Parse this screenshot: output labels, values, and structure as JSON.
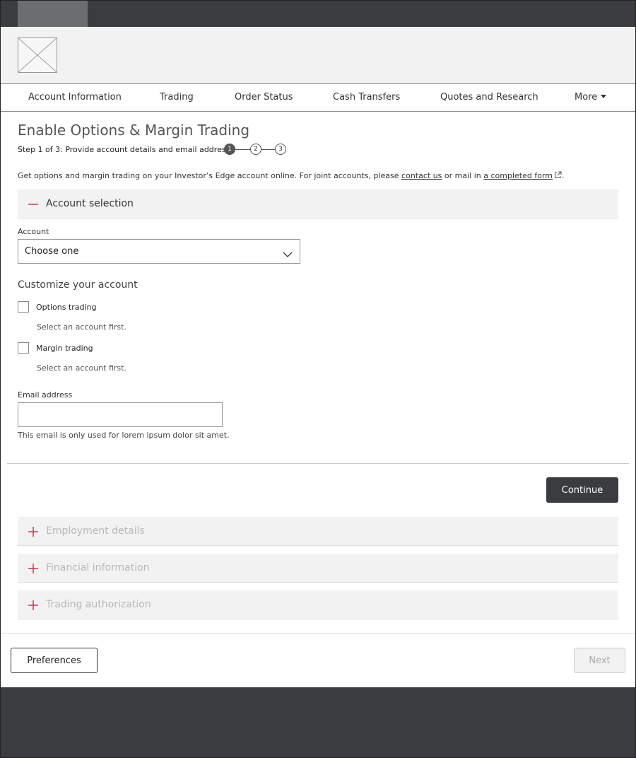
{
  "colors": {
    "dark": "#3a3c3f",
    "accent_red": "#d0344a",
    "panel_gray": "#f2f2f2",
    "disabled_text": "#b8b8b8"
  },
  "nav": {
    "items": [
      {
        "label": "Account Information"
      },
      {
        "label": "Trading"
      },
      {
        "label": "Order Status"
      },
      {
        "label": "Cash Transfers"
      },
      {
        "label": "Quotes and Research"
      },
      {
        "label": "More"
      }
    ]
  },
  "page": {
    "title": "Enable Options & Margin Trading",
    "step_text": "Step 1 of 3: Provide account details and email address",
    "steps": [
      "1",
      "2",
      "3"
    ],
    "current_step": 1,
    "intro_before_link": "Get options and margin trading on your Investor’s Edge account online. For joint accounts, please ",
    "contact_link": "contact us",
    "intro_middle": " or mail in ",
    "form_link": "a completed form",
    "intro_end": "."
  },
  "account_section": {
    "header": "Account selection",
    "icon": "minus-icon",
    "account_label": "Account",
    "account_select_value": "Choose one",
    "customize_heading": "Customize your account",
    "options_label": "Options trading",
    "options_hint": "Select an account first.",
    "margin_label": "Margin trading",
    "margin_hint": "Select an account first.",
    "email_label": "Email address",
    "email_value": "",
    "email_note": "This email is only used for lorem ipsum dolor sit amet.",
    "continue_label": "Continue"
  },
  "collapsed_sections": [
    {
      "label": "Employment details",
      "icon": "plus-icon"
    },
    {
      "label": "Financial information",
      "icon": "plus-icon"
    },
    {
      "label": "Trading authorization",
      "icon": "plus-icon"
    }
  ],
  "footer_actions": {
    "preferences_label": "Preferences",
    "next_label": "Next"
  }
}
